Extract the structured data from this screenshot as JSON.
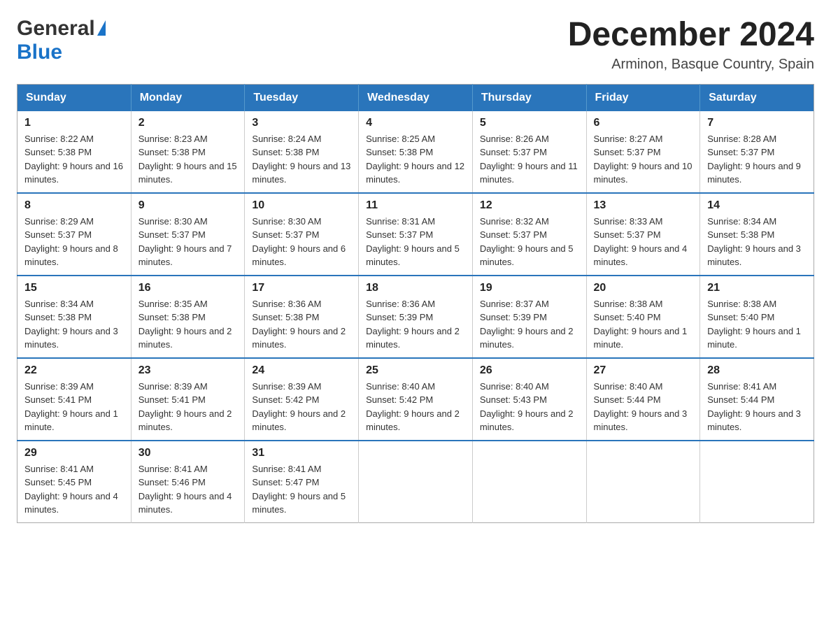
{
  "header": {
    "logo": {
      "general": "General",
      "blue": "Blue",
      "triangle_color": "#1a73c8"
    },
    "title": "December 2024",
    "subtitle": "Arminon, Basque Country, Spain"
  },
  "calendar": {
    "headers": [
      "Sunday",
      "Monday",
      "Tuesday",
      "Wednesday",
      "Thursday",
      "Friday",
      "Saturday"
    ],
    "weeks": [
      [
        {
          "day": "1",
          "sunrise": "8:22 AM",
          "sunset": "5:38 PM",
          "daylight": "9 hours and 16 minutes."
        },
        {
          "day": "2",
          "sunrise": "8:23 AM",
          "sunset": "5:38 PM",
          "daylight": "9 hours and 15 minutes."
        },
        {
          "day": "3",
          "sunrise": "8:24 AM",
          "sunset": "5:38 PM",
          "daylight": "9 hours and 13 minutes."
        },
        {
          "day": "4",
          "sunrise": "8:25 AM",
          "sunset": "5:38 PM",
          "daylight": "9 hours and 12 minutes."
        },
        {
          "day": "5",
          "sunrise": "8:26 AM",
          "sunset": "5:37 PM",
          "daylight": "9 hours and 11 minutes."
        },
        {
          "day": "6",
          "sunrise": "8:27 AM",
          "sunset": "5:37 PM",
          "daylight": "9 hours and 10 minutes."
        },
        {
          "day": "7",
          "sunrise": "8:28 AM",
          "sunset": "5:37 PM",
          "daylight": "9 hours and 9 minutes."
        }
      ],
      [
        {
          "day": "8",
          "sunrise": "8:29 AM",
          "sunset": "5:37 PM",
          "daylight": "9 hours and 8 minutes."
        },
        {
          "day": "9",
          "sunrise": "8:30 AM",
          "sunset": "5:37 PM",
          "daylight": "9 hours and 7 minutes."
        },
        {
          "day": "10",
          "sunrise": "8:30 AM",
          "sunset": "5:37 PM",
          "daylight": "9 hours and 6 minutes."
        },
        {
          "day": "11",
          "sunrise": "8:31 AM",
          "sunset": "5:37 PM",
          "daylight": "9 hours and 5 minutes."
        },
        {
          "day": "12",
          "sunrise": "8:32 AM",
          "sunset": "5:37 PM",
          "daylight": "9 hours and 5 minutes."
        },
        {
          "day": "13",
          "sunrise": "8:33 AM",
          "sunset": "5:37 PM",
          "daylight": "9 hours and 4 minutes."
        },
        {
          "day": "14",
          "sunrise": "8:34 AM",
          "sunset": "5:38 PM",
          "daylight": "9 hours and 3 minutes."
        }
      ],
      [
        {
          "day": "15",
          "sunrise": "8:34 AM",
          "sunset": "5:38 PM",
          "daylight": "9 hours and 3 minutes."
        },
        {
          "day": "16",
          "sunrise": "8:35 AM",
          "sunset": "5:38 PM",
          "daylight": "9 hours and 2 minutes."
        },
        {
          "day": "17",
          "sunrise": "8:36 AM",
          "sunset": "5:38 PM",
          "daylight": "9 hours and 2 minutes."
        },
        {
          "day": "18",
          "sunrise": "8:36 AM",
          "sunset": "5:39 PM",
          "daylight": "9 hours and 2 minutes."
        },
        {
          "day": "19",
          "sunrise": "8:37 AM",
          "sunset": "5:39 PM",
          "daylight": "9 hours and 2 minutes."
        },
        {
          "day": "20",
          "sunrise": "8:38 AM",
          "sunset": "5:40 PM",
          "daylight": "9 hours and 1 minute."
        },
        {
          "day": "21",
          "sunrise": "8:38 AM",
          "sunset": "5:40 PM",
          "daylight": "9 hours and 1 minute."
        }
      ],
      [
        {
          "day": "22",
          "sunrise": "8:39 AM",
          "sunset": "5:41 PM",
          "daylight": "9 hours and 1 minute."
        },
        {
          "day": "23",
          "sunrise": "8:39 AM",
          "sunset": "5:41 PM",
          "daylight": "9 hours and 2 minutes."
        },
        {
          "day": "24",
          "sunrise": "8:39 AM",
          "sunset": "5:42 PM",
          "daylight": "9 hours and 2 minutes."
        },
        {
          "day": "25",
          "sunrise": "8:40 AM",
          "sunset": "5:42 PM",
          "daylight": "9 hours and 2 minutes."
        },
        {
          "day": "26",
          "sunrise": "8:40 AM",
          "sunset": "5:43 PM",
          "daylight": "9 hours and 2 minutes."
        },
        {
          "day": "27",
          "sunrise": "8:40 AM",
          "sunset": "5:44 PM",
          "daylight": "9 hours and 3 minutes."
        },
        {
          "day": "28",
          "sunrise": "8:41 AM",
          "sunset": "5:44 PM",
          "daylight": "9 hours and 3 minutes."
        }
      ],
      [
        {
          "day": "29",
          "sunrise": "8:41 AM",
          "sunset": "5:45 PM",
          "daylight": "9 hours and 4 minutes."
        },
        {
          "day": "30",
          "sunrise": "8:41 AM",
          "sunset": "5:46 PM",
          "daylight": "9 hours and 4 minutes."
        },
        {
          "day": "31",
          "sunrise": "8:41 AM",
          "sunset": "5:47 PM",
          "daylight": "9 hours and 5 minutes."
        },
        null,
        null,
        null,
        null
      ]
    ],
    "labels": {
      "sunrise": "Sunrise:",
      "sunset": "Sunset:",
      "daylight": "Daylight:"
    }
  }
}
